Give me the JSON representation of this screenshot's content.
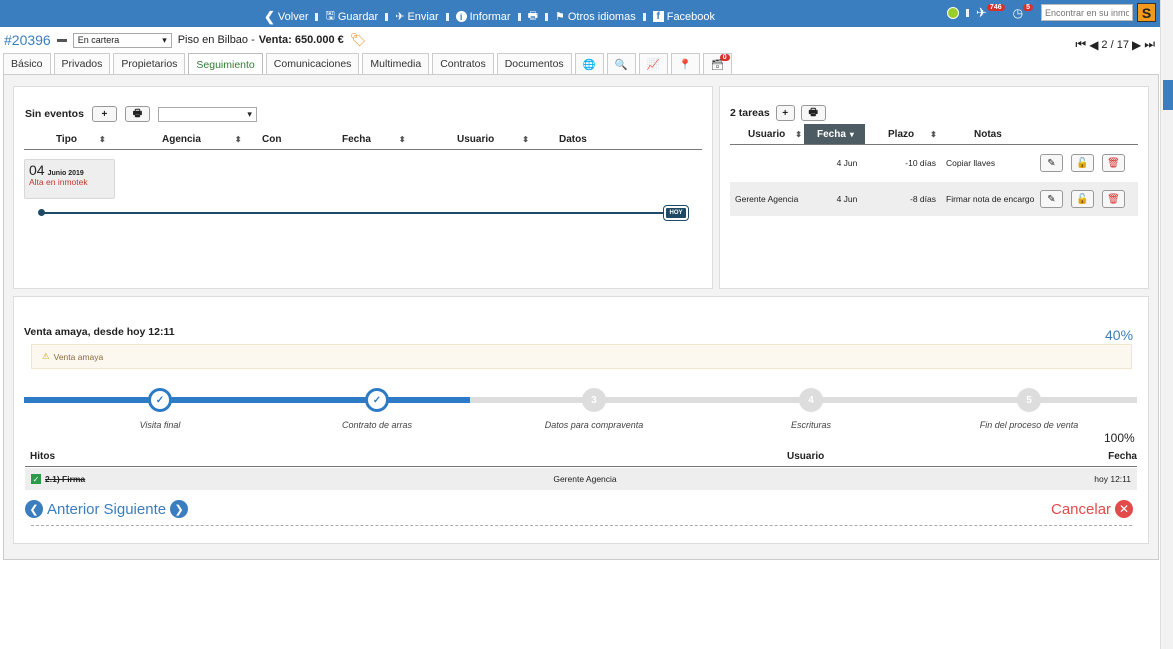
{
  "topbar": {
    "items": [
      "Volver",
      "Guardar",
      "Enviar",
      "Informar",
      "",
      "Otros idiomas",
      "Facebook"
    ],
    "notif_count": "746",
    "clock_count": "5",
    "search_placeholder": "Encontrar en su inmotek",
    "logo": "S",
    "color": "#3a7ebf"
  },
  "header": {
    "ref": "#20396",
    "status": "En cartera",
    "property": "Piso en Bilbao -",
    "sale": "Venta: 650.000 €",
    "pager": "2 / 17"
  },
  "tabs": [
    "Básico",
    "Privados",
    "Propietarios",
    "Seguimiento",
    "Comunicaciones",
    "Multimedia",
    "Contratos",
    "Documentos"
  ],
  "tab_icons": [
    "globe-icon",
    "zoom-icon",
    "chart-icon",
    "map-pin-icon",
    "inbox-icon"
  ],
  "inbox_badge": "0",
  "events": {
    "title": "Sin eventos",
    "columns": [
      "Tipo",
      "Agencia",
      "Con",
      "Fecha",
      "Usuario",
      "Datos"
    ],
    "card_day": "04",
    "card_month": "Junio 2019",
    "card_text": "Alta en inmotek",
    "today": "HOY"
  },
  "tasks": {
    "title": "2 tareas",
    "columns": [
      "Usuario",
      "Fecha",
      "Plazo",
      "Notas"
    ],
    "rows": [
      {
        "user": "",
        "date": "4 Jun",
        "term": "-10 días",
        "note": "Copiar llaves"
      },
      {
        "user": "Gerente Agencia",
        "date": "4 Jun",
        "term": "-8 días",
        "note": "Firmar nota de encargo"
      }
    ]
  },
  "process": {
    "title": "Venta amaya, desde hoy 12:11",
    "percent": "40%",
    "alert": "Venta amaya",
    "progress": 0.4,
    "steps": [
      {
        "label": "Visita final",
        "num": "",
        "done": true
      },
      {
        "label": "Contrato de arras",
        "num": "",
        "done": true
      },
      {
        "label": "Datos para compraventa",
        "num": "3",
        "done": false
      },
      {
        "label": "Escrituras",
        "num": "4",
        "done": false
      },
      {
        "label": "Fin del proceso de venta",
        "num": "5",
        "done": false
      }
    ],
    "sub_percent": "100%",
    "hitos_cols": [
      "Hitos",
      "Usuario",
      "Fecha"
    ],
    "hito": {
      "name": "2.1) Firma",
      "user": "Gerente Agencia",
      "date": "hoy 12:11"
    },
    "prev": "Anterior",
    "next": "Siguiente",
    "cancel": "Cancelar"
  }
}
